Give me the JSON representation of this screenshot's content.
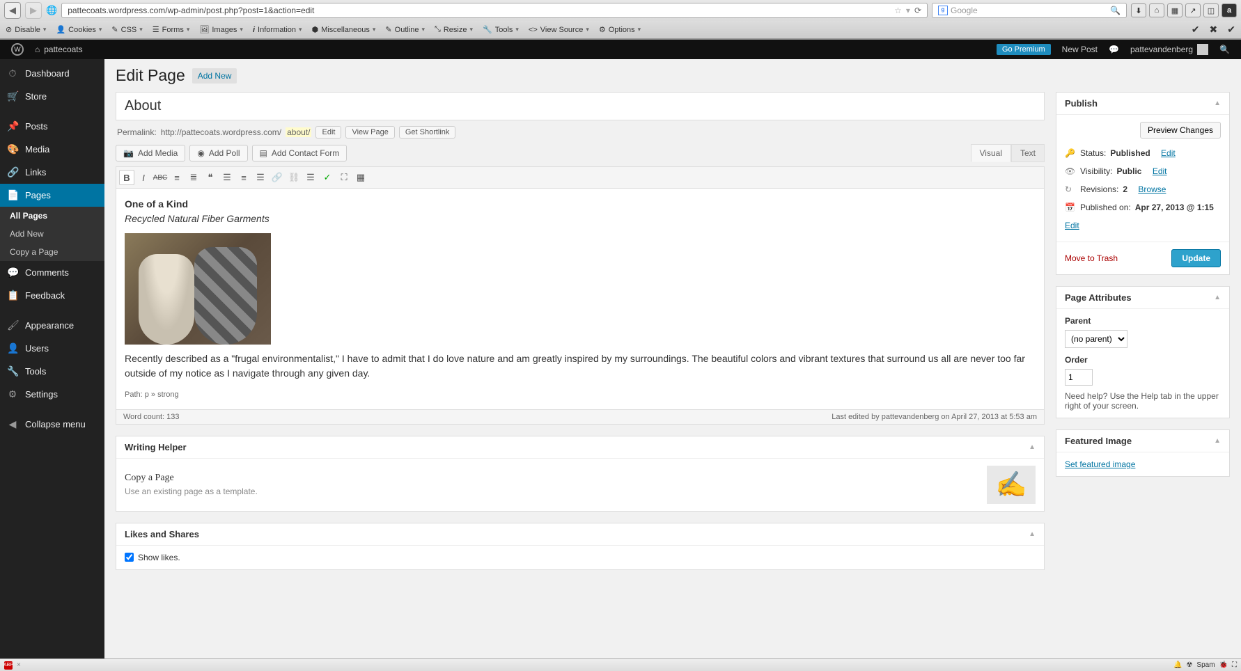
{
  "browser": {
    "url": "pattecoats.wordpress.com/wp-admin/post.php?post=1&action=edit",
    "search_placeholder": "Google"
  },
  "dev_toolbar": [
    "Disable",
    "Cookies",
    "CSS",
    "Forms",
    "Images",
    "Information",
    "Miscellaneous",
    "Outline",
    "Resize",
    "Tools",
    "View Source",
    "Options"
  ],
  "adminbar": {
    "site_name": "pattecoats",
    "go_premium": "Go Premium",
    "new_post": "New Post",
    "username": "pattevandenberg"
  },
  "adminmenu": {
    "items": [
      {
        "label": "Dashboard",
        "icon": "⏱"
      },
      {
        "label": "Store",
        "icon": "🛒"
      },
      {
        "label": "Posts",
        "icon": "📌"
      },
      {
        "label": "Media",
        "icon": "🎨"
      },
      {
        "label": "Links",
        "icon": "🔗"
      },
      {
        "label": "Pages",
        "icon": "📄",
        "active": true
      },
      {
        "label": "Comments",
        "icon": "💬"
      },
      {
        "label": "Feedback",
        "icon": "📋"
      },
      {
        "label": "Appearance",
        "icon": "🖌"
      },
      {
        "label": "Users",
        "icon": "👤"
      },
      {
        "label": "Tools",
        "icon": "🔧"
      },
      {
        "label": "Settings",
        "icon": "⚙"
      },
      {
        "label": "Collapse menu",
        "icon": "◀"
      }
    ],
    "submenu": [
      "All Pages",
      "Add New",
      "Copy a Page"
    ]
  },
  "page": {
    "heading": "Edit Page",
    "add_new": "Add New",
    "title": "About",
    "permalink_label": "Permalink:",
    "permalink_base": "http://pattecoats.wordpress.com/",
    "permalink_slug": "about/",
    "edit_btn": "Edit",
    "view_page_btn": "View Page",
    "shortlink_btn": "Get Shortlink",
    "add_media": "Add Media",
    "add_poll": "Add Poll",
    "add_contact": "Add Contact Form",
    "tab_visual": "Visual",
    "tab_text": "Text"
  },
  "editor": {
    "line1": "One of a Kind",
    "line2": "Recycled Natural Fiber Garments",
    "para": "Recently described as a \"frugal environmentalist,\" I have to admit that I do love nature and am greatly inspired by my surroundings.  The beautiful colors and vibrant textures that surround us all are never too far outside of my notice as I navigate through any given day.",
    "path": "Path: p » strong",
    "word_count_label": "Word count: ",
    "word_count": "133",
    "last_edited": "Last edited by pattevandenberg on April 27, 2013 at 5:53 am"
  },
  "writing_helper": {
    "title": "Writing Helper",
    "copy_title": "Copy a Page",
    "copy_sub": "Use an existing page as a template."
  },
  "likes": {
    "title": "Likes and Shares",
    "show_likes": "Show likes."
  },
  "publish": {
    "title": "Publish",
    "preview": "Preview Changes",
    "status_label": "Status: ",
    "status_value": "Published",
    "visibility_label": "Visibility: ",
    "visibility_value": "Public",
    "revisions_label": "Revisions: ",
    "revisions_value": "2",
    "browse": "Browse",
    "published_label": "Published on: ",
    "published_value": "Apr 27, 2013 @ 1:15",
    "edit_link": "Edit",
    "trash": "Move to Trash",
    "update": "Update"
  },
  "page_attributes": {
    "title": "Page Attributes",
    "parent_label": "Parent",
    "parent_value": "(no parent)",
    "order_label": "Order",
    "order_value": "1",
    "help": "Need help? Use the Help tab in the upper right of your screen."
  },
  "featured": {
    "title": "Featured Image",
    "link": "Set featured image"
  },
  "statusbar": {
    "spam": "Spam"
  }
}
